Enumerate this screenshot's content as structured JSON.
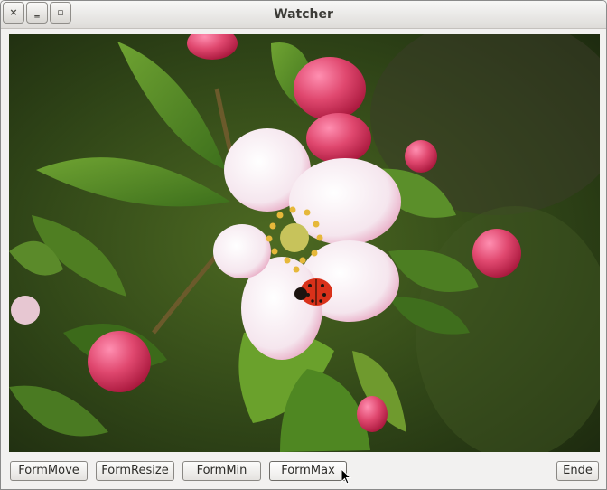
{
  "window": {
    "title": "Watcher",
    "close_glyph": "×",
    "minimize_glyph": "‗",
    "maximize_glyph": "▫"
  },
  "image": {
    "description_icon": "photo-apple-blossom-with-ladybug"
  },
  "buttons": {
    "form_move": "FormMove",
    "form_resize": "FormResize",
    "form_min": "FormMin",
    "form_max": "FormMax",
    "exit": "Ende"
  },
  "colors": {
    "window_bg": "#f2f1f0",
    "title_text": "#3c3b37"
  }
}
